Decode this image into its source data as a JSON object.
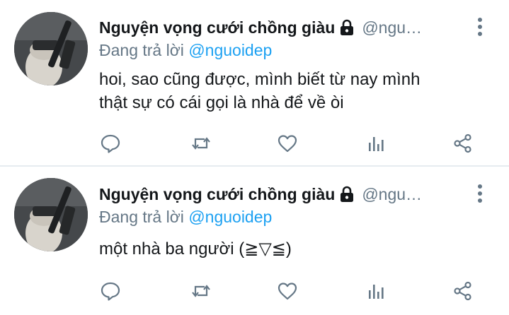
{
  "tweets": [
    {
      "display_name": "Nguyện vọng cưới chồng giàu",
      "handle": "@ngu…",
      "reply_prefix": "Đang trả lời ",
      "reply_mention": "@nguoidep",
      "text_line1": "hoi, sao cũng được, mình biết từ nay mình",
      "text_line2": "thật sự có cái gọi là nhà để về òi"
    },
    {
      "display_name": "Nguyện vọng cưới chồng giàu",
      "handle": "@ngu…",
      "reply_prefix": "Đang trả lời ",
      "reply_mention": "@nguoidep",
      "text_line1": "một nhà ba người (≧▽≦)"
    }
  ],
  "icons": {
    "lock": "lock-icon",
    "menu": "more-vertical-icon",
    "reply": "reply-icon",
    "retweet": "retweet-icon",
    "like": "heart-icon",
    "stats": "analytics-icon",
    "share": "share-icon"
  },
  "colors": {
    "text": "#14171a",
    "secondary": "#657786",
    "mention": "#1da1f2",
    "divider": "#e6ecf0"
  }
}
